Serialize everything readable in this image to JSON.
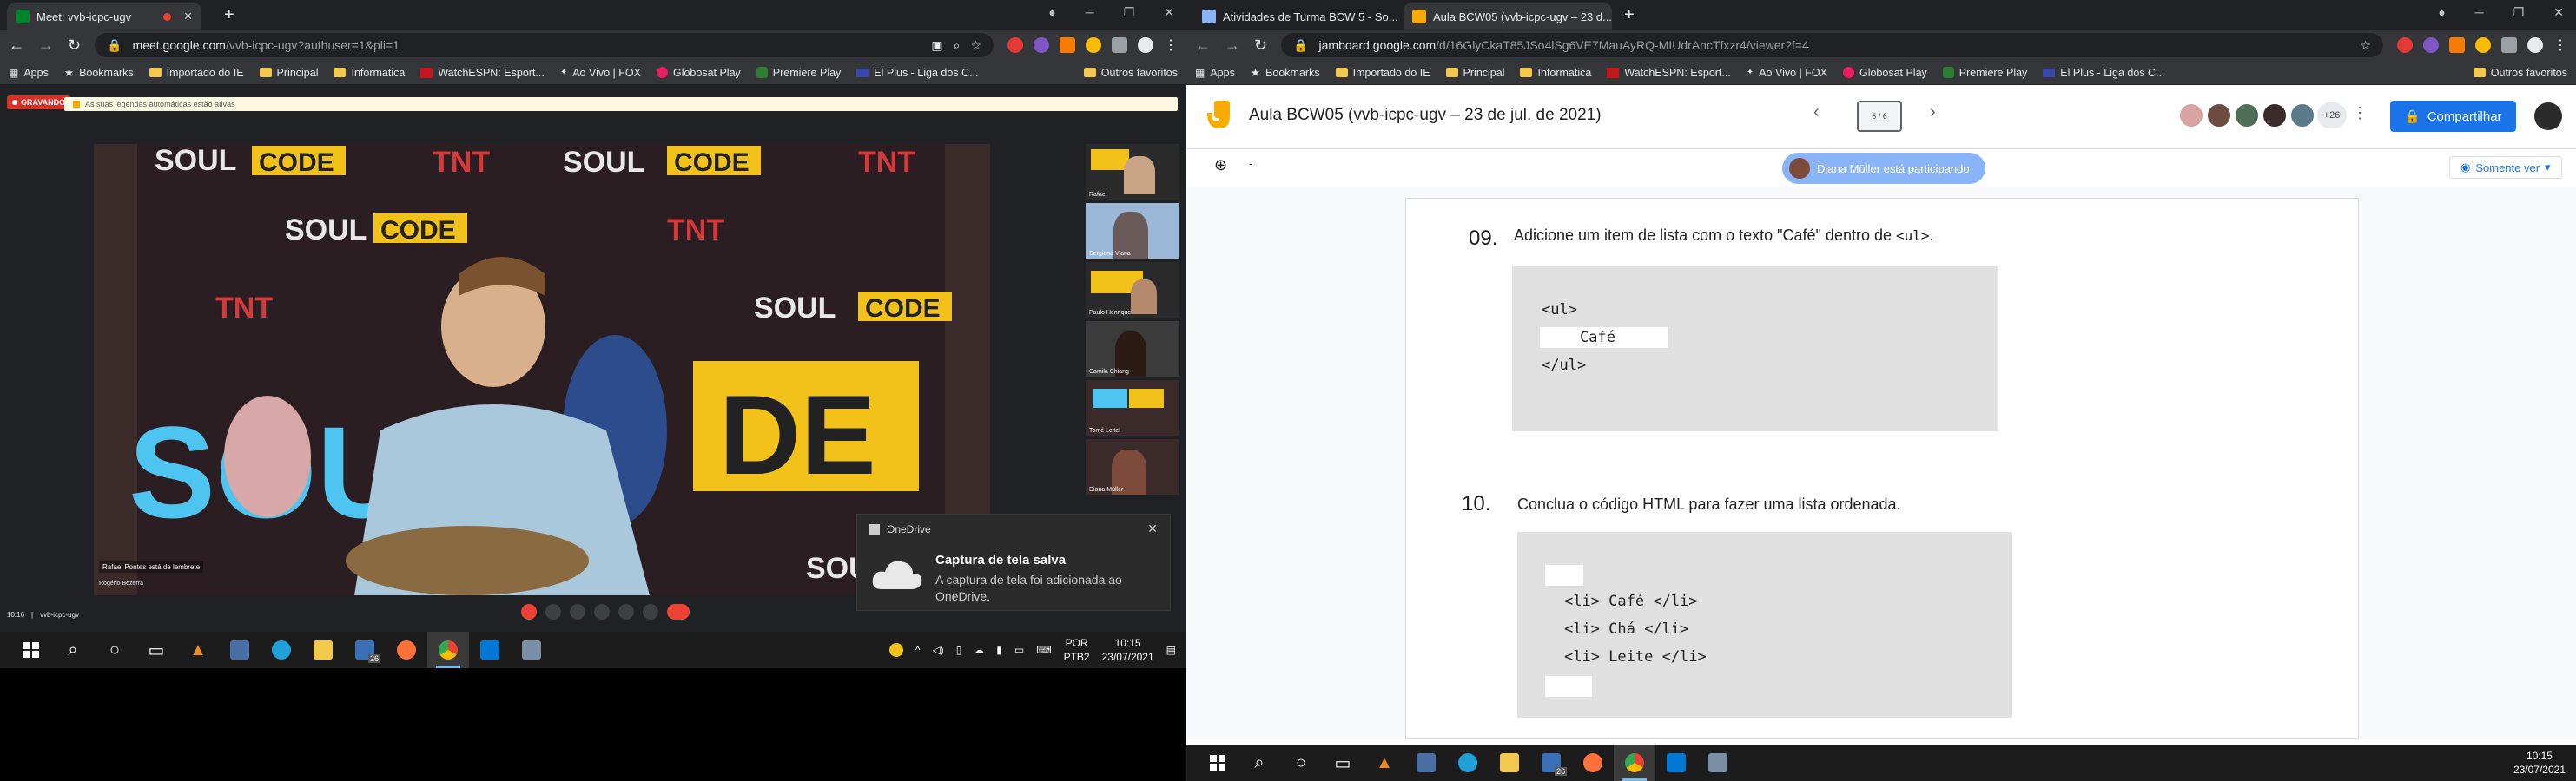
{
  "left": {
    "tabs": [
      {
        "title": "Meet: vvb-icpc-ugv",
        "active": true
      }
    ],
    "address": {
      "host": "meet.google.com",
      "path": "/vvb-icpc-ugv?authuser=1&pli=1"
    },
    "bookmarks": [
      {
        "label": "Apps",
        "icon": "apps-icon"
      },
      {
        "label": "Bookmarks",
        "icon": "star-icon"
      },
      {
        "label": "Importado do IE",
        "icon": "folder-icon"
      },
      {
        "label": "Principal",
        "icon": "folder-icon"
      },
      {
        "label": "Informatica",
        "icon": "folder-icon"
      },
      {
        "label": "WatchESPN: Esport...",
        "icon": "espn-icon"
      },
      {
        "label": "Ao Vivo | FOX",
        "icon": "fox-icon"
      },
      {
        "label": "Globosat Play",
        "icon": "globosat-icon"
      },
      {
        "label": "Premiere Play",
        "icon": "premiere-icon"
      },
      {
        "label": "El Plus - Liga dos C...",
        "icon": "elplus-icon"
      }
    ],
    "bookmarks_other": "Outros favoritos",
    "meet": {
      "recording_badge": "GRAVANDO",
      "banner_text": "As suas legendas automáticas estão ativas",
      "presenter_name": "Rafael Pontes está de lembrete",
      "presenter_sub": "Rogério Bezerra",
      "participants": [
        {
          "name": "Rafael"
        },
        {
          "name": "Sergiana Viana"
        },
        {
          "name": "Paulo Henrique"
        },
        {
          "name": "Camila Chiang"
        },
        {
          "name": "Tomé Leitel"
        },
        {
          "name": "Diana Müller"
        }
      ],
      "footer_time": "10:16",
      "footer_code": "vvb-icpc-ugv"
    },
    "toast": {
      "app": "OneDrive",
      "title": "Captura de tela salva",
      "body": "A captura de tela foi adicionada ao OneDrive."
    },
    "taskbar": {
      "lang1": "POR",
      "lang2": "PTB2",
      "time": "10:15",
      "date": "23/07/2021",
      "badge": "26"
    }
  },
  "right": {
    "tabs": [
      {
        "title": "Atividades de Turma BCW 5 - So..."
      },
      {
        "title": "Aula BCW05 (vvb-icpc-ugv – 23 d...",
        "active": true
      }
    ],
    "address": {
      "host": "jamboard.google.com",
      "path": "/d/16GlyCkaT85JSo4lSg6VE7MauAyRQ-MIUdrAncTfxzr4/viewer?f=4"
    },
    "bookmarks": [
      {
        "label": "Apps"
      },
      {
        "label": "Bookmarks"
      },
      {
        "label": "Importado do IE"
      },
      {
        "label": "Principal"
      },
      {
        "label": "Informatica"
      },
      {
        "label": "WatchESPN: Esport..."
      },
      {
        "label": "Ao Vivo | FOX"
      },
      {
        "label": "Globosat Play"
      },
      {
        "label": "Premiere Play"
      },
      {
        "label": "El Plus - Liga dos C..."
      }
    ],
    "bookmarks_other": "Outros favoritos",
    "jam": {
      "title": "Aula BCW05 (vvb-icpc-ugv – 23 de jul. de 2021)",
      "frame_counter": "5 / 6",
      "avatars_more": "+26",
      "share_label": "Compartilhar",
      "view_mode": "Somente ver",
      "participating": "Diana Müller está participando",
      "zoom_label": "-",
      "q9": {
        "number": "09.",
        "text_before": "Adicione um item de lista com o texto \"Café\" dentro de",
        "code_inline": "<ul>",
        "text_after": ".",
        "code_lines": [
          "<ul>",
          "Café",
          "</ul>"
        ]
      },
      "q10": {
        "number": "10.",
        "text": "Conclua o código HTML para fazer uma lista ordenada.",
        "code_lines": [
          "<li> Café </li>",
          "<li> Chá </li>",
          "<li> Leite </li>"
        ]
      }
    },
    "taskbar": {
      "time": "10:15",
      "date": "23/07/2021",
      "badge": "26"
    }
  }
}
